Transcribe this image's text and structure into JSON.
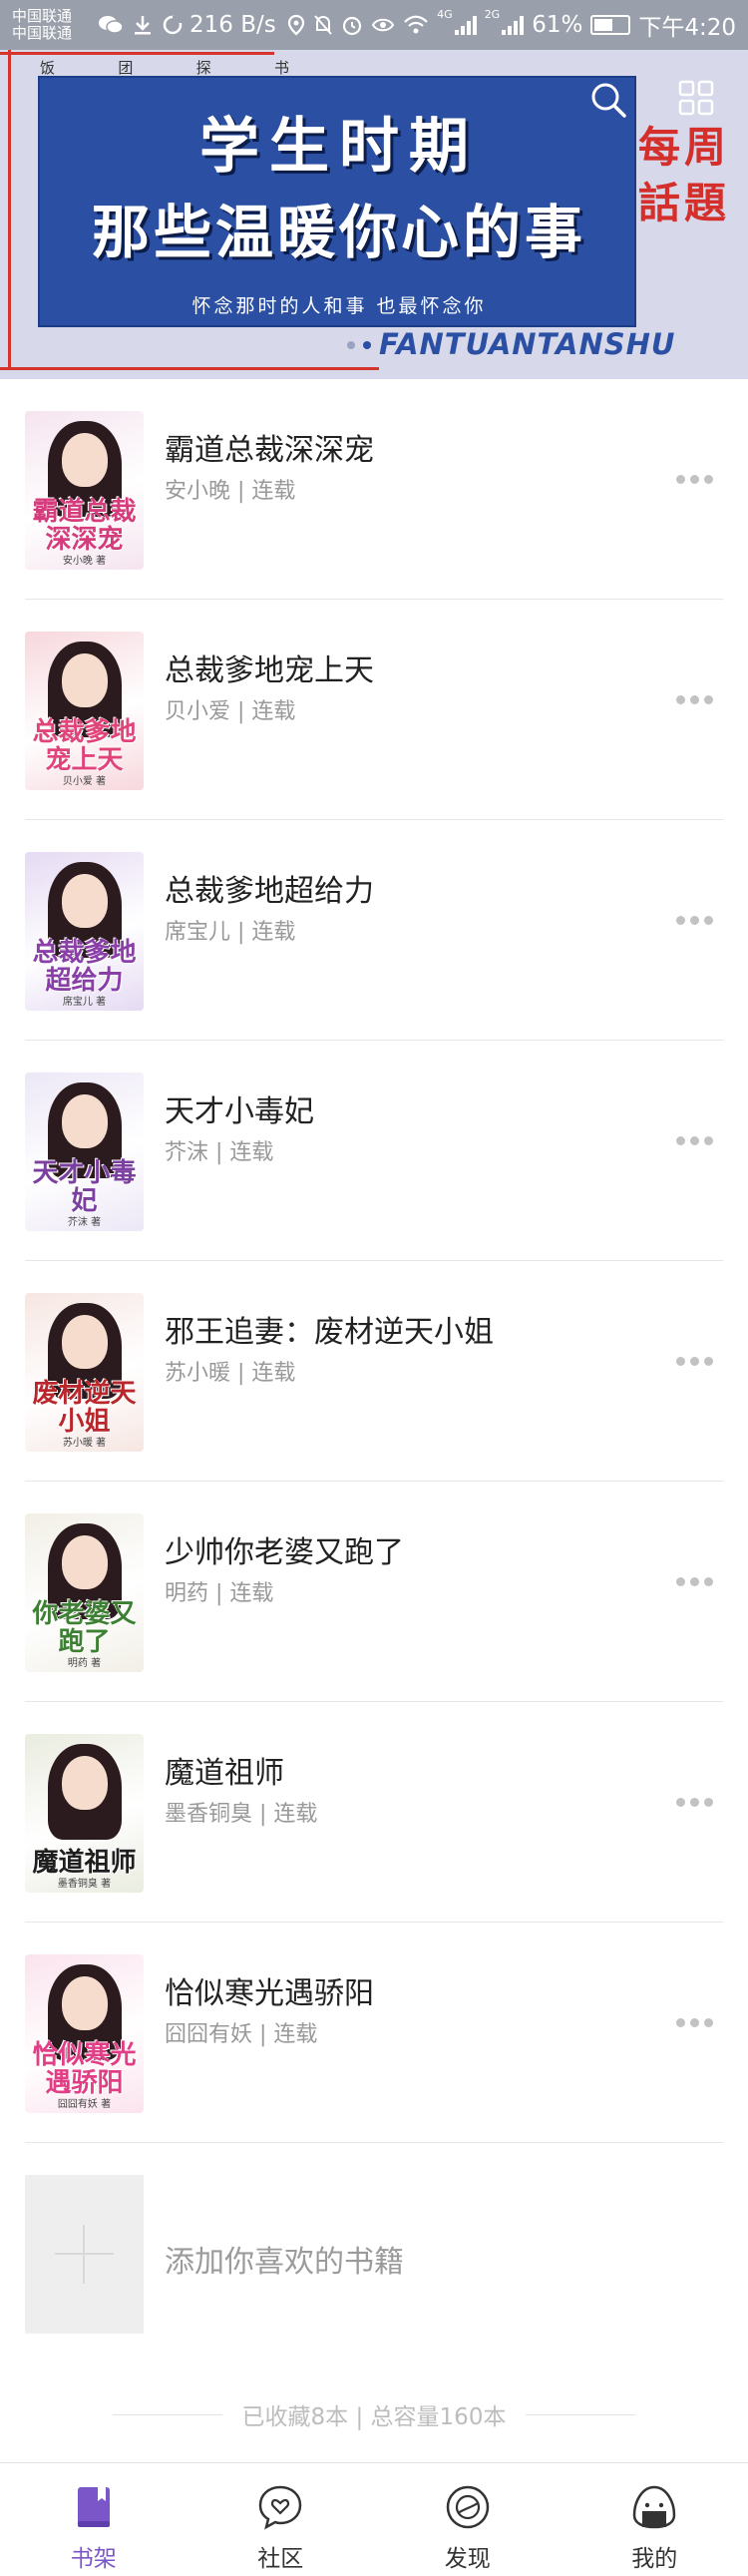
{
  "status_bar": {
    "carrier_1": "中国联通",
    "carrier_2": "中国联通",
    "speed": "216 B/s",
    "network_1": "4G",
    "network_2": "2G",
    "battery": "61%",
    "battery_level": 0.61,
    "time": "下午4:20"
  },
  "banner": {
    "pinyin": [
      "饭",
      "团",
      "探",
      "书"
    ],
    "title_line1": "学生时期",
    "title_line2": "那些温暖你心的事",
    "subtitle": "怀念那时的人和事 也最怀念你",
    "side_label_1": "每周",
    "side_label_2": "話題",
    "brand": "FANTUANTANSHU",
    "accent_color": "#2a4fa3",
    "red_color": "#d42f2a"
  },
  "books": [
    {
      "title": "霸道总裁深深宠",
      "author": "安小晚",
      "status": "连载",
      "cover_title": "霸道总裁深深宠",
      "cover_author": "安小晚 著",
      "cover_bg": "#f5e4ef",
      "cover_color": "#d43c7b"
    },
    {
      "title": "总裁爹地宠上天",
      "author": "贝小爱",
      "status": "连载",
      "cover_title": "总裁爹地宠上天",
      "cover_author": "贝小爱 著",
      "cover_bg": "#f7d7dd",
      "cover_color": "#e0447a"
    },
    {
      "title": "总裁爹地超给力",
      "author": "席宝儿",
      "status": "连载",
      "cover_title": "总裁爹地超给力",
      "cover_author": "席宝儿 著",
      "cover_bg": "#e5daf3",
      "cover_color": "#8a3fa8"
    },
    {
      "title": "天才小毒妃",
      "author": "芥沫",
      "status": "连载",
      "cover_title": "天才小毒妃",
      "cover_author": "芥沫 著",
      "cover_bg": "#ece7f6",
      "cover_color": "#7b3fa0"
    },
    {
      "title": "邪王追妻：废材逆天小姐",
      "author": "苏小暖",
      "status": "连载",
      "cover_title": "废材逆天小姐",
      "cover_author": "苏小暖 著",
      "cover_bg": "#f6e6e2",
      "cover_color": "#b9262b"
    },
    {
      "title": "少帅你老婆又跑了",
      "author": "明药",
      "status": "连载",
      "cover_title": "你老婆又跑了",
      "cover_author": "明药 著",
      "cover_bg": "#f1efe6",
      "cover_color": "#3d7f33"
    },
    {
      "title": "魔道祖师",
      "author": "墨香铜臭",
      "status": "连载",
      "cover_title": "魔道祖师",
      "cover_author": "墨香铜臭 著",
      "cover_bg": "#e9ecdf",
      "cover_color": "#1f1f1f"
    },
    {
      "title": "恰似寒光遇骄阳",
      "author": "囧囧有妖",
      "status": "连载",
      "cover_title": "恰似寒光遇骄阳",
      "cover_author": "囧囧有妖 著",
      "cover_bg": "#fbe3ee",
      "cover_color": "#e23e86"
    }
  ],
  "add_book_label": "添加你喜欢的书籍",
  "summary": "已收藏8本 | 总容量160本",
  "tabs": [
    {
      "label": "书架",
      "icon": "bookshelf-icon",
      "active": true
    },
    {
      "label": "社区",
      "icon": "community-icon",
      "active": false
    },
    {
      "label": "发现",
      "icon": "discover-icon",
      "active": false
    },
    {
      "label": "我的",
      "icon": "profile-icon",
      "active": false
    }
  ],
  "colors": {
    "active_tab": "#7b56c8",
    "meta_text": "#999999"
  }
}
